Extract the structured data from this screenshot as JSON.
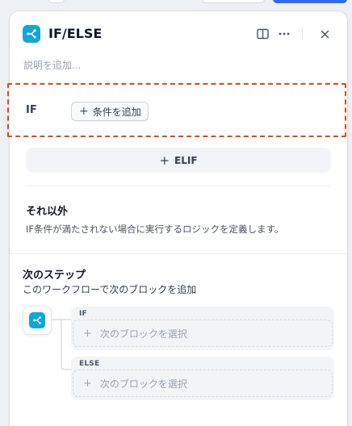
{
  "panel": {
    "title": "IF/ELSE",
    "description_placeholder": "説明を追加...",
    "icon": "if-else-branch-icon",
    "accent": "#11a6d8"
  },
  "header_actions": {
    "book_icon": "book-open-icon",
    "more_icon": "more-dots-icon",
    "close_icon": "close-icon"
  },
  "if_section": {
    "label": "IF",
    "add_condition_label": "条件を追加",
    "highlight_color": "#e1481f"
  },
  "elif": {
    "label": "ELIF"
  },
  "else_section": {
    "title": "それ以外",
    "description": "IF条件が満たされない場合に実行するロジックを定義します。"
  },
  "next_step": {
    "title": "次のステップ",
    "description": "このワークフローで次のブロックを追加",
    "branches": [
      {
        "label": "IF",
        "select_label": "次のブロックを選択"
      },
      {
        "label": "ELSE",
        "select_label": "次のブロックを選択"
      }
    ]
  }
}
